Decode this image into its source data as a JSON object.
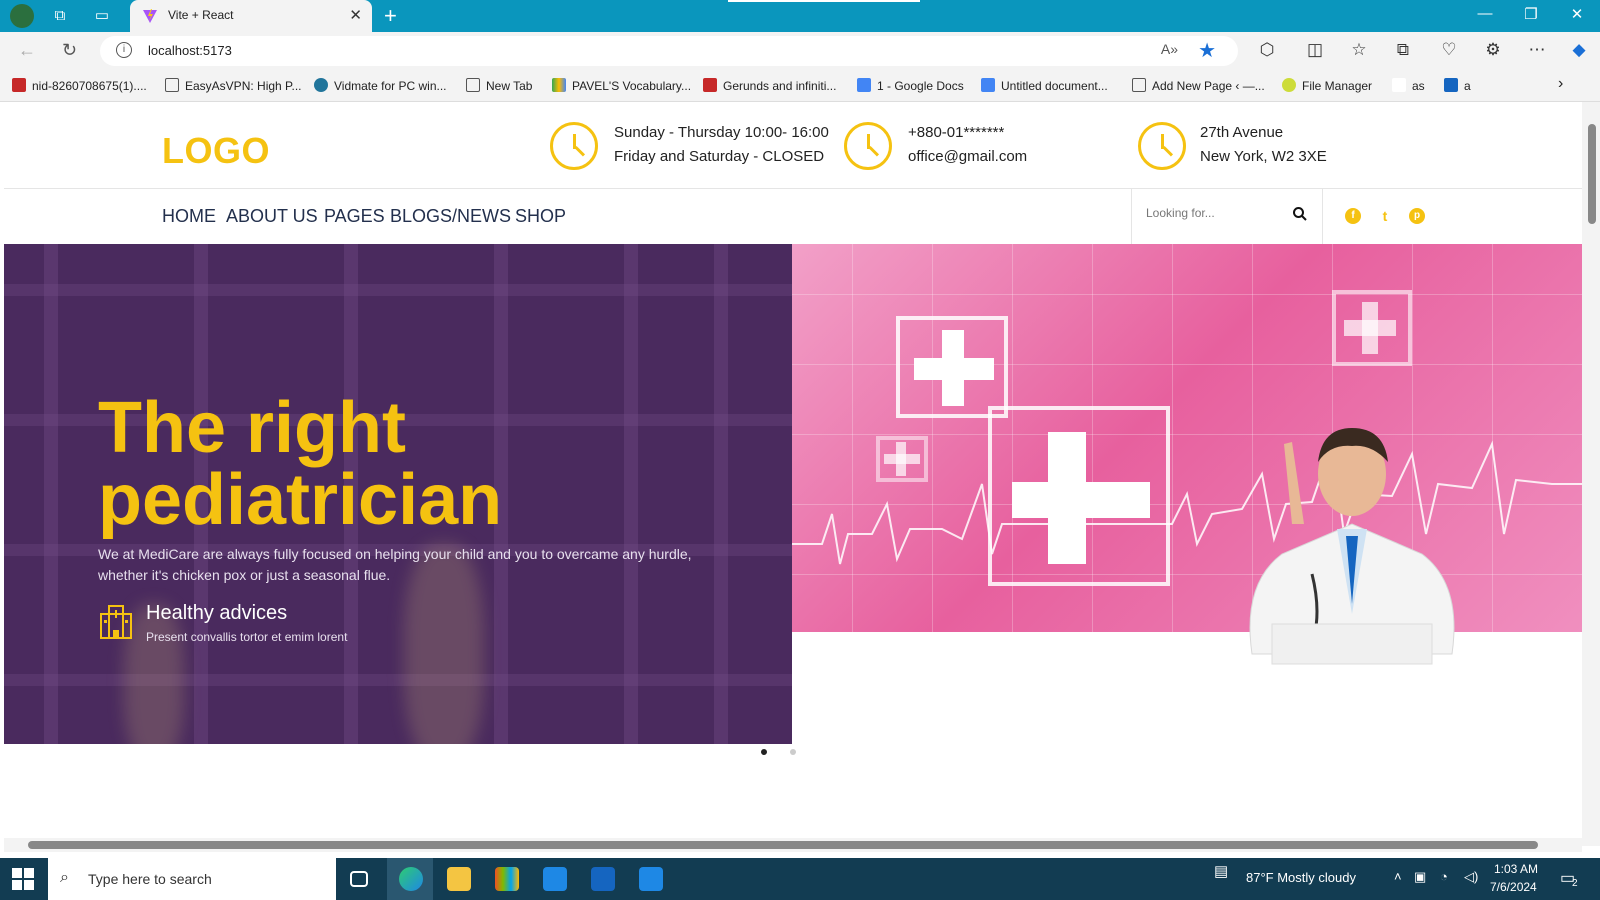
{
  "browser": {
    "tab_title": "Vite + React",
    "url": "localhost:5173",
    "bookmarks": [
      "nid-8260708675(1)....",
      "EasyAsVPN: High P...",
      "Vidmate for PC win...",
      "New Tab",
      "PAVEL'S Vocabulary...",
      "Gerunds and infiniti...",
      "1 - Google Docs",
      "Untitled document...",
      "Add New Page ‹ —...",
      "File Manager",
      "as",
      "a"
    ]
  },
  "site": {
    "logo": "LOGO",
    "hours_line1": "Sunday - Thursday 10:00- 16:00",
    "hours_line2": "Friday and Saturday - CLOSED",
    "phone": "+880-01*******",
    "email": "office@gmail.com",
    "address_line1": "27th Avenue",
    "address_line2": "New York, W2 3XE",
    "nav": [
      "HOME",
      "ABOUT US",
      "PAGES",
      "BLOGS/NEWS",
      "SHOP"
    ],
    "search_placeholder": "Looking for...",
    "social_icons": [
      "facebook-icon",
      "twitter-icon",
      "pinterest-icon"
    ]
  },
  "hero": {
    "title_line1": "The right",
    "title_line2": "pediatrician",
    "description": "We at MediCare are always fully focused on helping your child and you to overcame any hurdle, whether it's chicken pox or just a seasonal flue.",
    "feature_title": "Healthy advices",
    "feature_subtitle": "Present convallis tortor et emim lorent",
    "slides": 2,
    "active_slide": 1
  },
  "taskbar": {
    "search_text": "Type here to search",
    "weather": "87°F  Mostly cloudy",
    "time": "1:03 AM",
    "date": "7/6/2024",
    "notifications": "2"
  },
  "colors": {
    "accent": "#f5c211",
    "hero_purple": "#4a2a5e",
    "nav_text": "#23304d",
    "browser_chrome": "#0a96bd"
  }
}
